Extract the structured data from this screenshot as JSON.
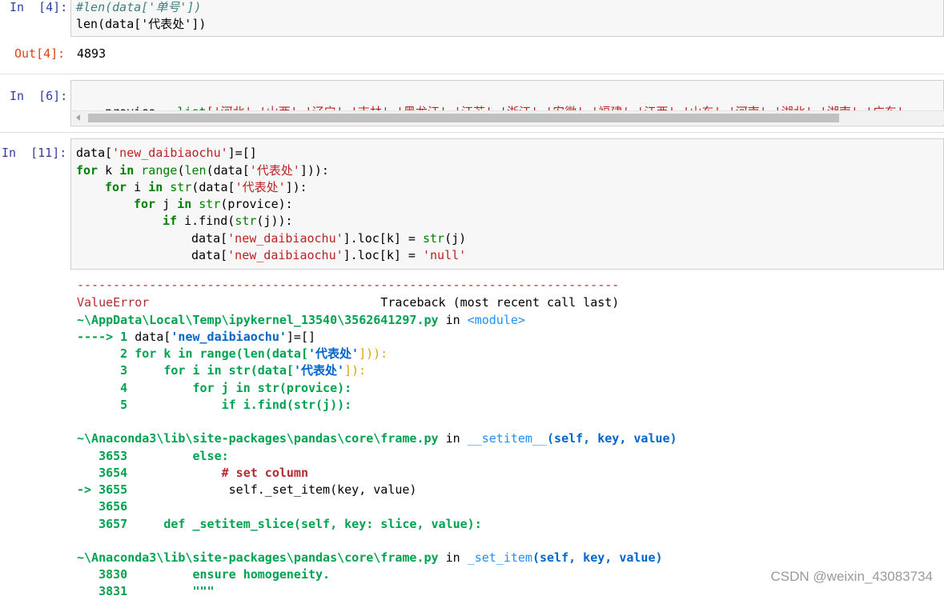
{
  "cell4": {
    "in_prompt": "In  [4]:",
    "code": [
      "#len(data['单号'])",
      "len(data['代表处'])"
    ],
    "out_prompt": "Out[4]:",
    "output": "4893"
  },
  "cell6": {
    "in_prompt": "In  [6]:",
    "code_var": "provice",
    "code_eq": " = ",
    "code_fn": "list",
    "code_rest": "['河北','山西','辽宁','吉林','黑龙江','江苏','浙江','安徽','福建','江西','山东','河南','湖北','湖南','广东'"
  },
  "cell11": {
    "in_prompt": "In  [11]:",
    "l1a": "data[",
    "l1s": "'new_daibiaochu'",
    "l1b": "]=[]",
    "l2kw1": "for",
    "l2a": " k ",
    "l2kw2": "in",
    "l2b": " ",
    "l2bi1": "range",
    "l2c": "(",
    "l2bi2": "len",
    "l2d": "(data[",
    "l2s": "'代表处'",
    "l2e": "])):",
    "l3kw1": "for",
    "l3a": " i ",
    "l3kw2": "in",
    "l3b": " ",
    "l3bi": "str",
    "l3c": "(data[",
    "l3s": "'代表处'",
    "l3d": "]):",
    "l4kw1": "for",
    "l4a": " j ",
    "l4kw2": "in",
    "l4b": " ",
    "l4bi": "str",
    "l4c": "(provice):",
    "l5kw": "if",
    "l5a": " i.find(",
    "l5bi": "str",
    "l5b": "(j)):",
    "l6a": "data[",
    "l6s": "'new_daibiaochu'",
    "l6b": "].loc[k] = ",
    "l6bi": "str",
    "l6c": "(j)",
    "l7a": "data[",
    "l7s": "'new_daibiaochu'",
    "l7b": "].loc[k] = ",
    "l7s2": "'null'"
  },
  "traceback": {
    "dashes": "---------------------------------------------------------------------------",
    "error_name": "ValueError",
    "header_rest": "                                Traceback (most recent call last)",
    "frame1_path": "~\\AppData\\Local\\Temp\\ipykernel_13540\\3562641297.py",
    "frame1_in": " in ",
    "frame1_func": "<module>",
    "f1_arrow": "----> 1 ",
    "f1_l1a": "data[",
    "f1_l1s": "'new_daibiaochu'",
    "f1_l1b": "]=[]",
    "f1_l2n": "      2 ",
    "f1_l2": "for k in range(len(data[",
    "f1_l2s": "'代表处'",
    "f1_l2e": "])):",
    "f1_l3n": "      3 ",
    "f1_l3": "    for i in str(data[",
    "f1_l3s": "'代表处'",
    "f1_l3e": "]):",
    "f1_l4n": "      4 ",
    "f1_l4": "        for j in str(provice):",
    "f1_l5n": "      5 ",
    "f1_l5": "            if i.find(str(j)):",
    "frame2_path": "~\\Anaconda3\\lib\\site-packages\\pandas\\core\\frame.py",
    "frame2_in": " in ",
    "frame2_func": "__setitem__",
    "frame2_args": "(self, key, value)",
    "f2_l1n": "   3653 ",
    "f2_l1": "        else:",
    "f2_l2n": "   3654 ",
    "f2_l2": "            # set column",
    "f2_l3n": "-> 3655 ",
    "f2_l3": "             self._set_item(key, value)",
    "f2_l4n": "   3656 ",
    "f2_l5n": "   3657 ",
    "f2_l5": "    def _setitem_slice(self, key: slice, value):",
    "frame3_path": "~\\Anaconda3\\lib\\site-packages\\pandas\\core\\frame.py",
    "frame3_in": " in ",
    "frame3_func": "_set_item",
    "frame3_args": "(self, key, value)",
    "f3_l1n": "   3830 ",
    "f3_l1": "        ensure homogeneity.",
    "f3_l2n": "   3831 ",
    "f3_l2": "        \"\"\""
  },
  "watermark": "CSDN @weixin_43083734"
}
